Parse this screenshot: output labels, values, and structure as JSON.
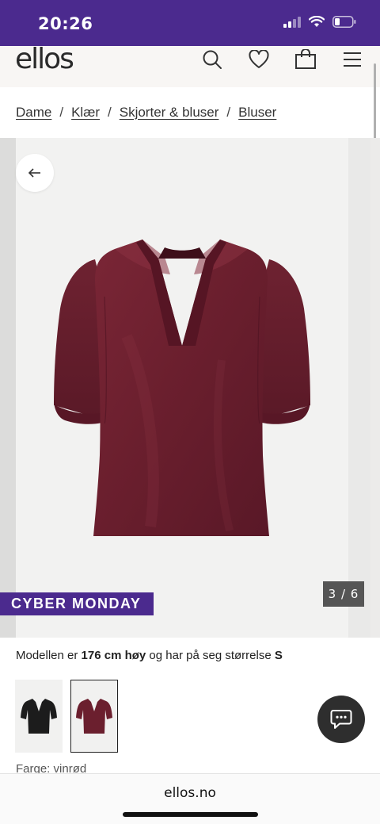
{
  "status_bar": {
    "time": "20:26",
    "icons": [
      "signal-icon",
      "wifi-icon",
      "battery-icon"
    ],
    "background": "#4b2a8e"
  },
  "header": {
    "logo": "ellos",
    "icons": [
      "search-icon",
      "heart-icon",
      "bag-icon",
      "menu-icon"
    ]
  },
  "breadcrumb": {
    "items": [
      "Dame",
      "Klær",
      "Skjorter & bluser",
      "Bluser"
    ],
    "separator": "/"
  },
  "gallery": {
    "counter": "3 / 6",
    "promo_badge": "CYBER MONDAY",
    "promo_color": "#4b2a8e",
    "product_color": "#6b1f2e"
  },
  "model_info": {
    "prefix": "Modellen er ",
    "height": "176 cm høy",
    "middle": " og har på seg størrelse ",
    "size": "S"
  },
  "swatches": [
    {
      "color": "#1c1c1c",
      "selected": false
    },
    {
      "color": "#6b1f2e",
      "selected": true
    }
  ],
  "color_label": "Farge: vinrød",
  "browser": {
    "url": "ellos.no"
  }
}
